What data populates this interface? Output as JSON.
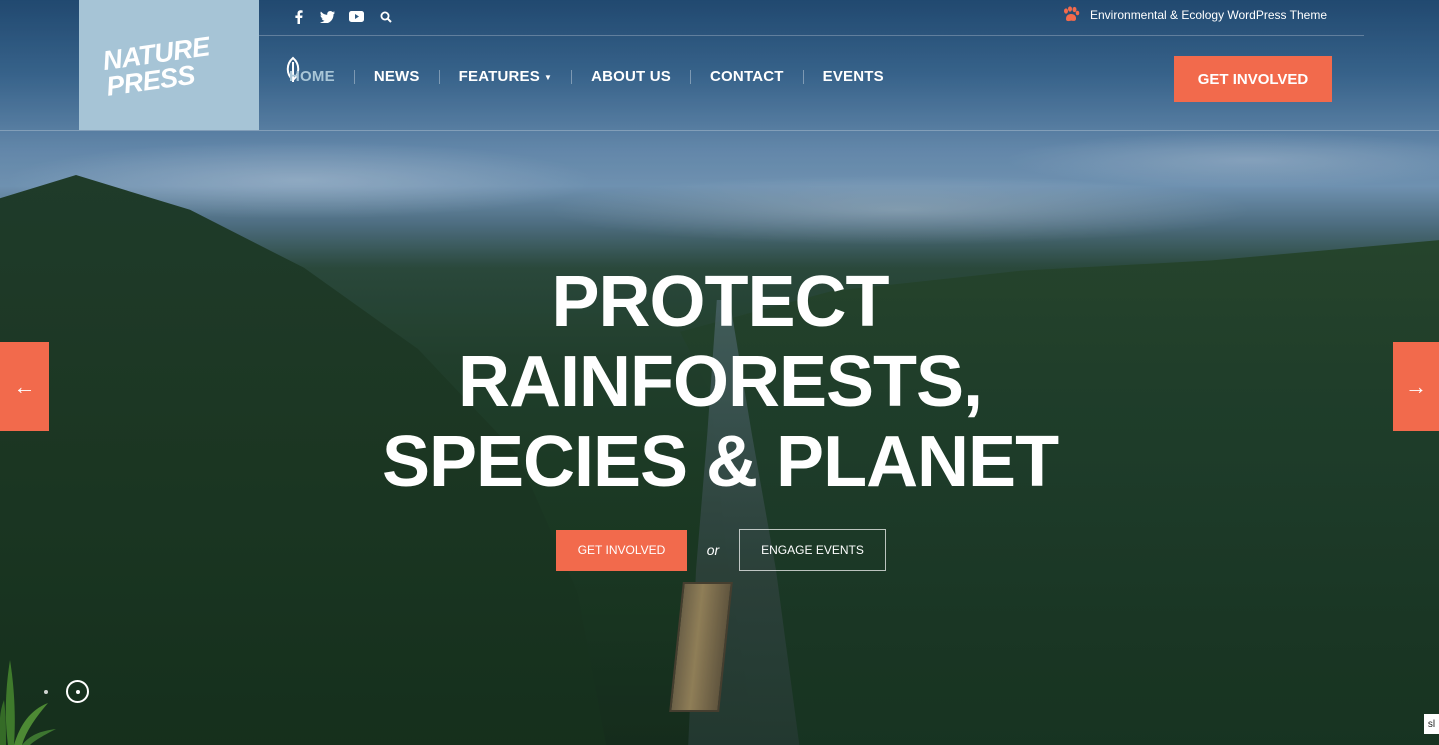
{
  "colors": {
    "accent": "#f26a4c",
    "logo_bg": "#a6c4d6",
    "nav_active": "#a9c6d7"
  },
  "logo": {
    "line1": "NATURE",
    "line2": "PRESS"
  },
  "social_icons": [
    "facebook-icon",
    "twitter-icon",
    "youtube-icon",
    "search-icon"
  ],
  "tagline": {
    "icon": "paw-icon",
    "text": "Environmental & Ecology WordPress Theme"
  },
  "nav": {
    "items": [
      {
        "label": "HOME",
        "active": true
      },
      {
        "label": "NEWS"
      },
      {
        "label": "FEATURES",
        "has_dropdown": true
      },
      {
        "label": "ABOUT US"
      },
      {
        "label": "CONTACT"
      },
      {
        "label": "EVENTS"
      }
    ],
    "cta_label": "GET INVOLVED"
  },
  "hero": {
    "headline_lines": [
      "PROTECT",
      "RAINFORESTS,",
      "SPECIES & PLANET"
    ],
    "primary_label": "GET INVOLVED",
    "or_text": "or",
    "secondary_label": "ENGAGE EVENTS",
    "prev_arrow": "←",
    "next_arrow": "→"
  },
  "corner_label": "sl"
}
